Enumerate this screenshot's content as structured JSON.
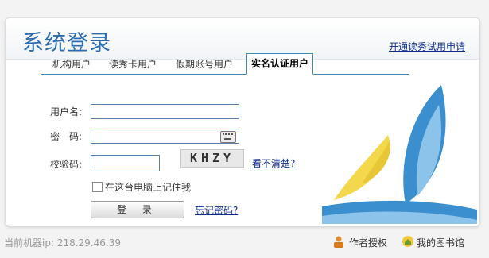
{
  "header": {
    "title": "系统登录",
    "apply_link": "开通读秀试用申请"
  },
  "tabs": [
    {
      "label": "机构用户",
      "active": false
    },
    {
      "label": "读秀卡用户",
      "active": false
    },
    {
      "label": "假期账号用户",
      "active": false
    },
    {
      "label": "实名认证用户",
      "active": true
    }
  ],
  "form": {
    "username_label": "用户名:",
    "username_value": "",
    "password_label": "密　码:",
    "password_value": "",
    "captcha_label": "校验码:",
    "captcha_value": "",
    "captcha_image_text": "KHZY",
    "refresh_captcha": "看不清楚?",
    "remember_label": "在这台电脑上记住我",
    "remember_checked": false,
    "login_button": "登 录",
    "forgot_link": "忘记密码?"
  },
  "footer": {
    "ip_text": "当前机器ip: 218.29.46.39",
    "author_auth": "作者授权",
    "my_library": "我的图书馆"
  },
  "colors": {
    "title_blue": "#2c6cae",
    "link_blue": "#0b2c8a",
    "tab_border": "#3d8ab8",
    "sail_yellow": "#f2d84a",
    "sail_blue": "#3b8fcf"
  }
}
